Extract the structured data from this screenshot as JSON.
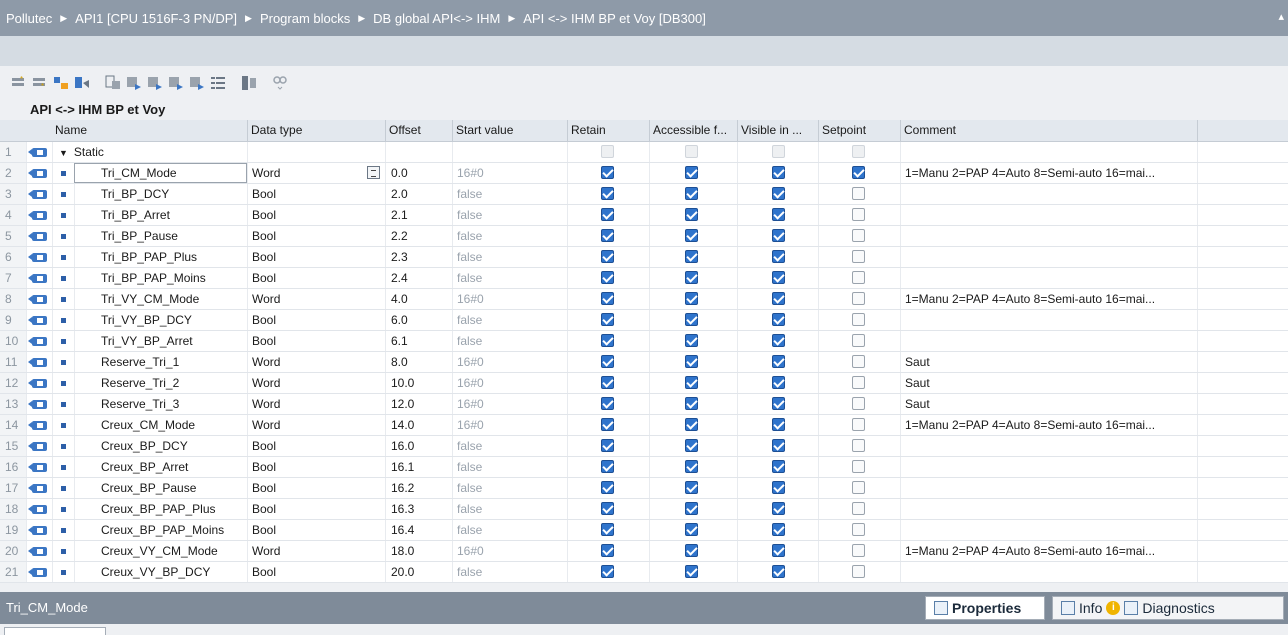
{
  "breadcrumb": [
    "Pollutec",
    "API1 [CPU 1516F-3 PN/DP]",
    "Program blocks",
    "DB global API<-> IHM",
    "API <-> IHM BP et Voy [DB300]"
  ],
  "db_title": "API <-> IHM BP et Voy",
  "columns": [
    "Name",
    "Data type",
    "Offset",
    "Start value",
    "Retain",
    "Accessible f...",
    "Visible in ...",
    "Setpoint",
    "Comment"
  ],
  "static_row": {
    "num": "1",
    "name": "Static"
  },
  "rows": [
    {
      "num": "2",
      "name": "Tri_CM_Mode",
      "type": "Word",
      "offset": "0.0",
      "start": "16#0",
      "retain": true,
      "accessible": true,
      "visible": true,
      "setpoint": true,
      "comment": "1=Manu 2=PAP 4=Auto 8=Semi-auto 16=mai..."
    },
    {
      "num": "3",
      "name": "Tri_BP_DCY",
      "type": "Bool",
      "offset": "2.0",
      "start": "false",
      "retain": true,
      "accessible": true,
      "visible": true,
      "setpoint": false,
      "comment": ""
    },
    {
      "num": "4",
      "name": "Tri_BP_Arret",
      "type": "Bool",
      "offset": "2.1",
      "start": "false",
      "retain": true,
      "accessible": true,
      "visible": true,
      "setpoint": false,
      "comment": ""
    },
    {
      "num": "5",
      "name": "Tri_BP_Pause",
      "type": "Bool",
      "offset": "2.2",
      "start": "false",
      "retain": true,
      "accessible": true,
      "visible": true,
      "setpoint": false,
      "comment": ""
    },
    {
      "num": "6",
      "name": "Tri_BP_PAP_Plus",
      "type": "Bool",
      "offset": "2.3",
      "start": "false",
      "retain": true,
      "accessible": true,
      "visible": true,
      "setpoint": false,
      "comment": ""
    },
    {
      "num": "7",
      "name": "Tri_BP_PAP_Moins",
      "type": "Bool",
      "offset": "2.4",
      "start": "false",
      "retain": true,
      "accessible": true,
      "visible": true,
      "setpoint": false,
      "comment": ""
    },
    {
      "num": "8",
      "name": "Tri_VY_CM_Mode",
      "type": "Word",
      "offset": "4.0",
      "start": "16#0",
      "retain": true,
      "accessible": true,
      "visible": true,
      "setpoint": false,
      "comment": "1=Manu 2=PAP 4=Auto 8=Semi-auto 16=mai..."
    },
    {
      "num": "9",
      "name": "Tri_VY_BP_DCY",
      "type": "Bool",
      "offset": "6.0",
      "start": "false",
      "retain": true,
      "accessible": true,
      "visible": true,
      "setpoint": false,
      "comment": ""
    },
    {
      "num": "10",
      "name": "Tri_VY_BP_Arret",
      "type": "Bool",
      "offset": "6.1",
      "start": "false",
      "retain": true,
      "accessible": true,
      "visible": true,
      "setpoint": false,
      "comment": ""
    },
    {
      "num": "11",
      "name": "Reserve_Tri_1",
      "type": "Word",
      "offset": "8.0",
      "start": "16#0",
      "retain": true,
      "accessible": true,
      "visible": true,
      "setpoint": false,
      "comment": "Saut"
    },
    {
      "num": "12",
      "name": "Reserve_Tri_2",
      "type": "Word",
      "offset": "10.0",
      "start": "16#0",
      "retain": true,
      "accessible": true,
      "visible": true,
      "setpoint": false,
      "comment": "Saut"
    },
    {
      "num": "13",
      "name": "Reserve_Tri_3",
      "type": "Word",
      "offset": "12.0",
      "start": "16#0",
      "retain": true,
      "accessible": true,
      "visible": true,
      "setpoint": false,
      "comment": "Saut"
    },
    {
      "num": "14",
      "name": "Creux_CM_Mode",
      "type": "Word",
      "offset": "14.0",
      "start": "16#0",
      "retain": true,
      "accessible": true,
      "visible": true,
      "setpoint": false,
      "comment": "1=Manu 2=PAP 4=Auto 8=Semi-auto 16=mai..."
    },
    {
      "num": "15",
      "name": "Creux_BP_DCY",
      "type": "Bool",
      "offset": "16.0",
      "start": "false",
      "retain": true,
      "accessible": true,
      "visible": true,
      "setpoint": false,
      "comment": ""
    },
    {
      "num": "16",
      "name": "Creux_BP_Arret",
      "type": "Bool",
      "offset": "16.1",
      "start": "false",
      "retain": true,
      "accessible": true,
      "visible": true,
      "setpoint": false,
      "comment": ""
    },
    {
      "num": "17",
      "name": "Creux_BP_Pause",
      "type": "Bool",
      "offset": "16.2",
      "start": "false",
      "retain": true,
      "accessible": true,
      "visible": true,
      "setpoint": false,
      "comment": ""
    },
    {
      "num": "18",
      "name": "Creux_BP_PAP_Plus",
      "type": "Bool",
      "offset": "16.3",
      "start": "false",
      "retain": true,
      "accessible": true,
      "visible": true,
      "setpoint": false,
      "comment": ""
    },
    {
      "num": "19",
      "name": "Creux_BP_PAP_Moins",
      "type": "Bool",
      "offset": "16.4",
      "start": "false",
      "retain": true,
      "accessible": true,
      "visible": true,
      "setpoint": false,
      "comment": ""
    },
    {
      "num": "20",
      "name": "Creux_VY_CM_Mode",
      "type": "Word",
      "offset": "18.0",
      "start": "16#0",
      "retain": true,
      "accessible": true,
      "visible": true,
      "setpoint": false,
      "comment": "1=Manu 2=PAP 4=Auto 8=Semi-auto 16=mai..."
    },
    {
      "num": "21",
      "name": "Creux_VY_BP_DCY",
      "type": "Bool",
      "offset": "20.0",
      "start": "false",
      "retain": true,
      "accessible": true,
      "visible": true,
      "setpoint": false,
      "comment": ""
    }
  ],
  "selected_row": 0,
  "bottom": {
    "selected_label": "Tri_CM_Mode",
    "properties_tab": "Properties",
    "info_tab": "Info",
    "diagnostics_tab": "Diagnostics"
  },
  "colors": {
    "title_bar": "#8e9aa8",
    "checkbox_on": "#2f74cc",
    "panel_bar": "#7f8b99"
  }
}
